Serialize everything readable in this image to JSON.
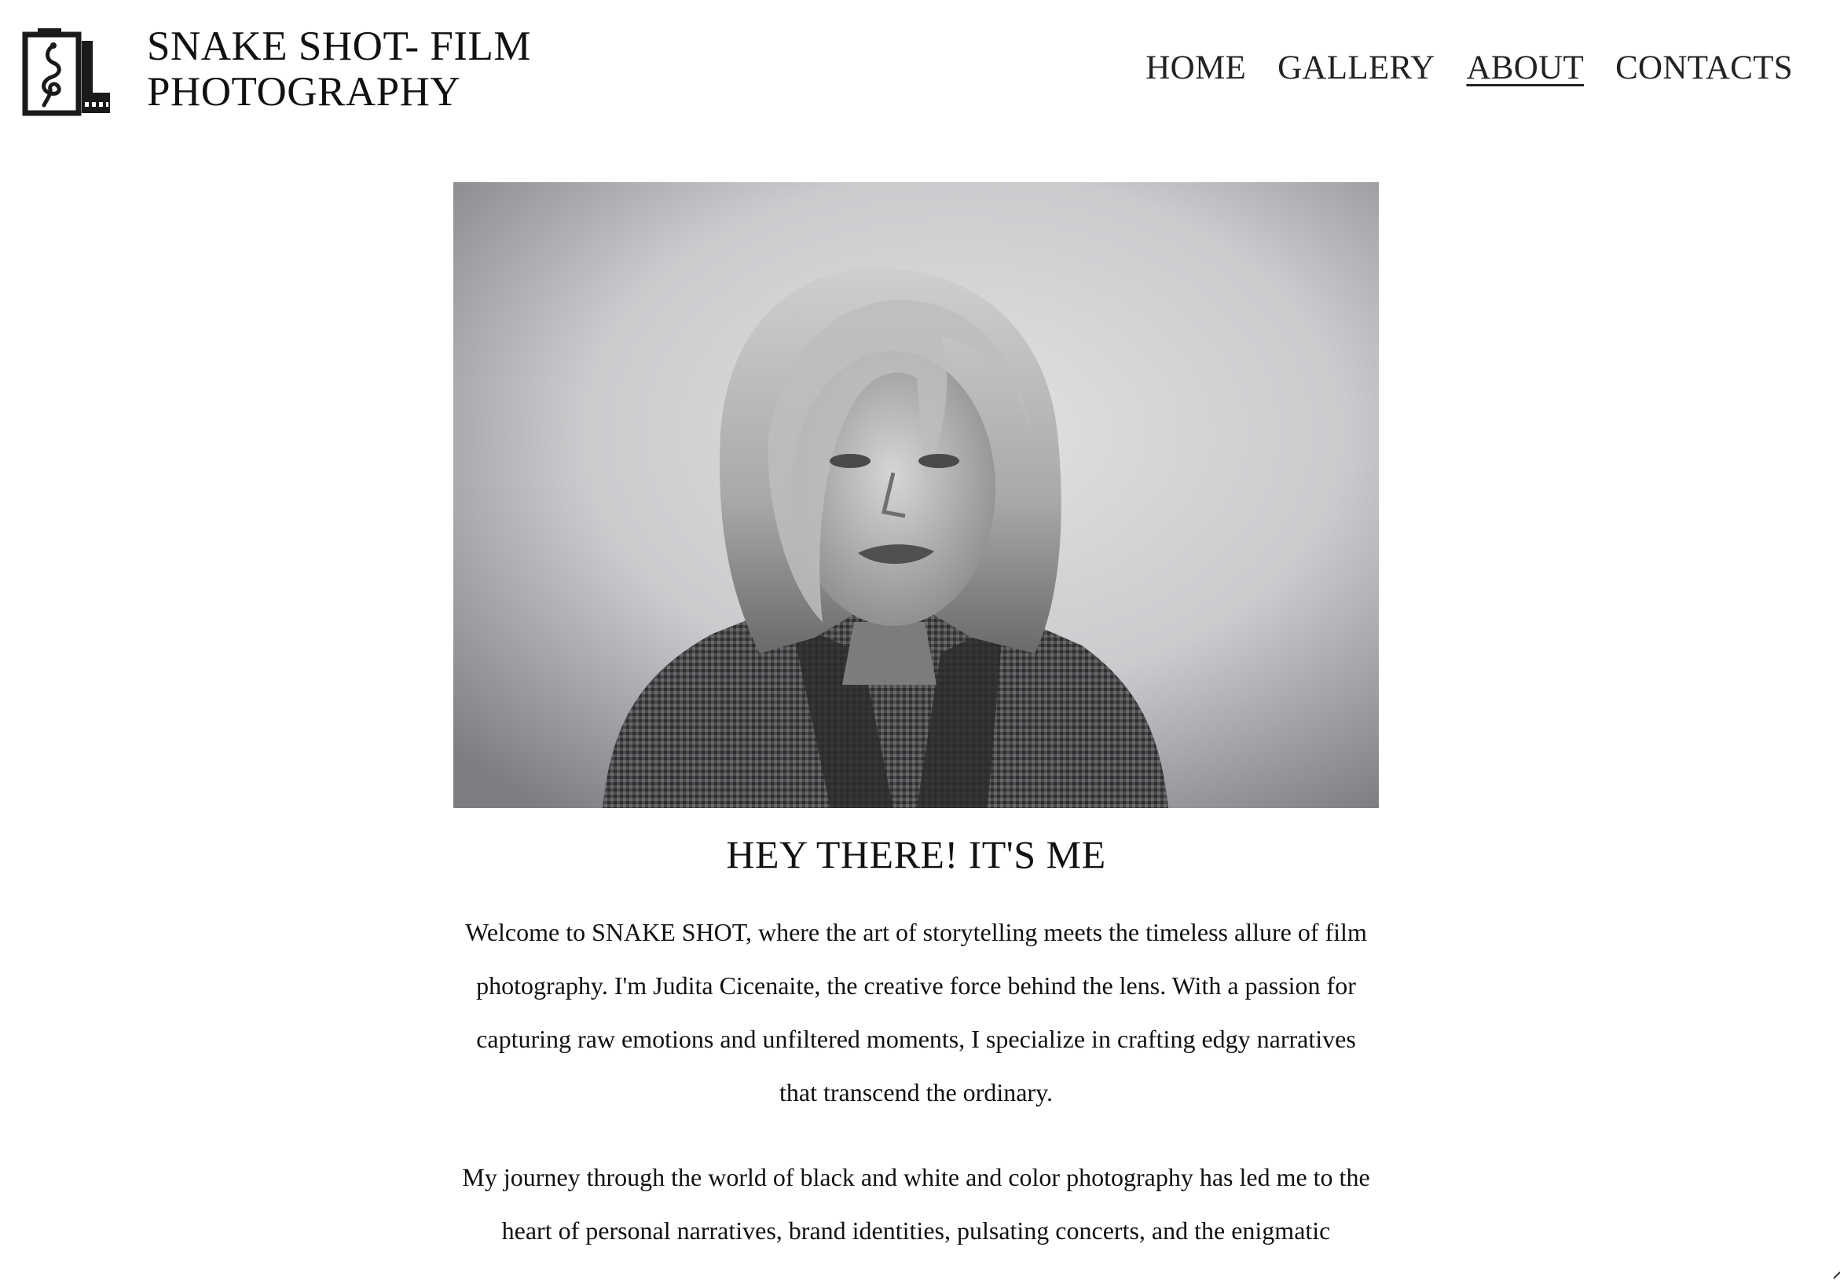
{
  "header": {
    "brand_line1": "SNAKE SHOT- FILM",
    "brand_line2": "PHOTOGRAPHY",
    "logo_icon": "film-canister-snake-icon"
  },
  "nav": {
    "items": [
      {
        "label": "HOME",
        "active": false
      },
      {
        "label": "GALLERY",
        "active": false
      },
      {
        "label": "ABOUT",
        "active": true
      },
      {
        "label": "CONTACTS",
        "active": false
      }
    ]
  },
  "main": {
    "heading": "HEY THERE! IT'S ME",
    "paragraph1": "Welcome to SNAKE SHOT, where the art of storytelling meets the timeless allure of film photography. I'm Judita Cicenaite, the creative force behind the lens. With a passion for capturing raw emotions and unfiltered moments, I specialize in crafting edgy narratives that transcend the ordinary.",
    "paragraph2": "My journey through the world of black and white and color photography has led me to the heart of personal narratives, brand identities, pulsating concerts, and the enigmatic"
  },
  "colors": {
    "background": "#ffffff",
    "text": "#111111"
  }
}
